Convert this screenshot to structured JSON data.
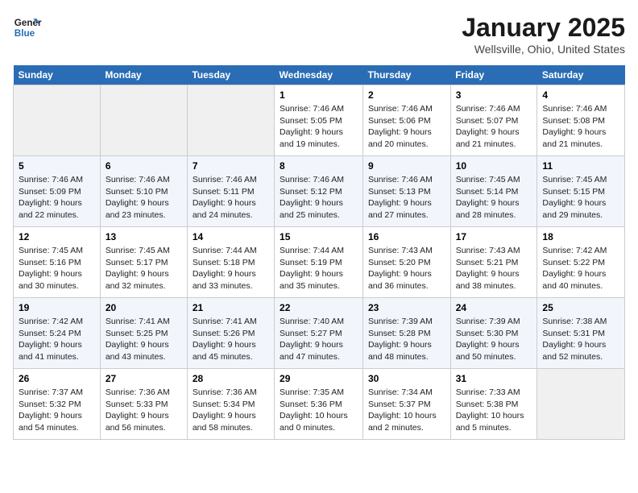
{
  "header": {
    "logo_line1": "General",
    "logo_line2": "Blue",
    "title": "January 2025",
    "subtitle": "Wellsville, Ohio, United States"
  },
  "days_of_week": [
    "Sunday",
    "Monday",
    "Tuesday",
    "Wednesday",
    "Thursday",
    "Friday",
    "Saturday"
  ],
  "weeks": [
    [
      {
        "day": "",
        "info": ""
      },
      {
        "day": "",
        "info": ""
      },
      {
        "day": "",
        "info": ""
      },
      {
        "day": "1",
        "info": "Sunrise: 7:46 AM\nSunset: 5:05 PM\nDaylight: 9 hours\nand 19 minutes."
      },
      {
        "day": "2",
        "info": "Sunrise: 7:46 AM\nSunset: 5:06 PM\nDaylight: 9 hours\nand 20 minutes."
      },
      {
        "day": "3",
        "info": "Sunrise: 7:46 AM\nSunset: 5:07 PM\nDaylight: 9 hours\nand 21 minutes."
      },
      {
        "day": "4",
        "info": "Sunrise: 7:46 AM\nSunset: 5:08 PM\nDaylight: 9 hours\nand 21 minutes."
      }
    ],
    [
      {
        "day": "5",
        "info": "Sunrise: 7:46 AM\nSunset: 5:09 PM\nDaylight: 9 hours\nand 22 minutes."
      },
      {
        "day": "6",
        "info": "Sunrise: 7:46 AM\nSunset: 5:10 PM\nDaylight: 9 hours\nand 23 minutes."
      },
      {
        "day": "7",
        "info": "Sunrise: 7:46 AM\nSunset: 5:11 PM\nDaylight: 9 hours\nand 24 minutes."
      },
      {
        "day": "8",
        "info": "Sunrise: 7:46 AM\nSunset: 5:12 PM\nDaylight: 9 hours\nand 25 minutes."
      },
      {
        "day": "9",
        "info": "Sunrise: 7:46 AM\nSunset: 5:13 PM\nDaylight: 9 hours\nand 27 minutes."
      },
      {
        "day": "10",
        "info": "Sunrise: 7:45 AM\nSunset: 5:14 PM\nDaylight: 9 hours\nand 28 minutes."
      },
      {
        "day": "11",
        "info": "Sunrise: 7:45 AM\nSunset: 5:15 PM\nDaylight: 9 hours\nand 29 minutes."
      }
    ],
    [
      {
        "day": "12",
        "info": "Sunrise: 7:45 AM\nSunset: 5:16 PM\nDaylight: 9 hours\nand 30 minutes."
      },
      {
        "day": "13",
        "info": "Sunrise: 7:45 AM\nSunset: 5:17 PM\nDaylight: 9 hours\nand 32 minutes."
      },
      {
        "day": "14",
        "info": "Sunrise: 7:44 AM\nSunset: 5:18 PM\nDaylight: 9 hours\nand 33 minutes."
      },
      {
        "day": "15",
        "info": "Sunrise: 7:44 AM\nSunset: 5:19 PM\nDaylight: 9 hours\nand 35 minutes."
      },
      {
        "day": "16",
        "info": "Sunrise: 7:43 AM\nSunset: 5:20 PM\nDaylight: 9 hours\nand 36 minutes."
      },
      {
        "day": "17",
        "info": "Sunrise: 7:43 AM\nSunset: 5:21 PM\nDaylight: 9 hours\nand 38 minutes."
      },
      {
        "day": "18",
        "info": "Sunrise: 7:42 AM\nSunset: 5:22 PM\nDaylight: 9 hours\nand 40 minutes."
      }
    ],
    [
      {
        "day": "19",
        "info": "Sunrise: 7:42 AM\nSunset: 5:24 PM\nDaylight: 9 hours\nand 41 minutes."
      },
      {
        "day": "20",
        "info": "Sunrise: 7:41 AM\nSunset: 5:25 PM\nDaylight: 9 hours\nand 43 minutes."
      },
      {
        "day": "21",
        "info": "Sunrise: 7:41 AM\nSunset: 5:26 PM\nDaylight: 9 hours\nand 45 minutes."
      },
      {
        "day": "22",
        "info": "Sunrise: 7:40 AM\nSunset: 5:27 PM\nDaylight: 9 hours\nand 47 minutes."
      },
      {
        "day": "23",
        "info": "Sunrise: 7:39 AM\nSunset: 5:28 PM\nDaylight: 9 hours\nand 48 minutes."
      },
      {
        "day": "24",
        "info": "Sunrise: 7:39 AM\nSunset: 5:30 PM\nDaylight: 9 hours\nand 50 minutes."
      },
      {
        "day": "25",
        "info": "Sunrise: 7:38 AM\nSunset: 5:31 PM\nDaylight: 9 hours\nand 52 minutes."
      }
    ],
    [
      {
        "day": "26",
        "info": "Sunrise: 7:37 AM\nSunset: 5:32 PM\nDaylight: 9 hours\nand 54 minutes."
      },
      {
        "day": "27",
        "info": "Sunrise: 7:36 AM\nSunset: 5:33 PM\nDaylight: 9 hours\nand 56 minutes."
      },
      {
        "day": "28",
        "info": "Sunrise: 7:36 AM\nSunset: 5:34 PM\nDaylight: 9 hours\nand 58 minutes."
      },
      {
        "day": "29",
        "info": "Sunrise: 7:35 AM\nSunset: 5:36 PM\nDaylight: 10 hours\nand 0 minutes."
      },
      {
        "day": "30",
        "info": "Sunrise: 7:34 AM\nSunset: 5:37 PM\nDaylight: 10 hours\nand 2 minutes."
      },
      {
        "day": "31",
        "info": "Sunrise: 7:33 AM\nSunset: 5:38 PM\nDaylight: 10 hours\nand 5 minutes."
      },
      {
        "day": "",
        "info": ""
      }
    ]
  ]
}
